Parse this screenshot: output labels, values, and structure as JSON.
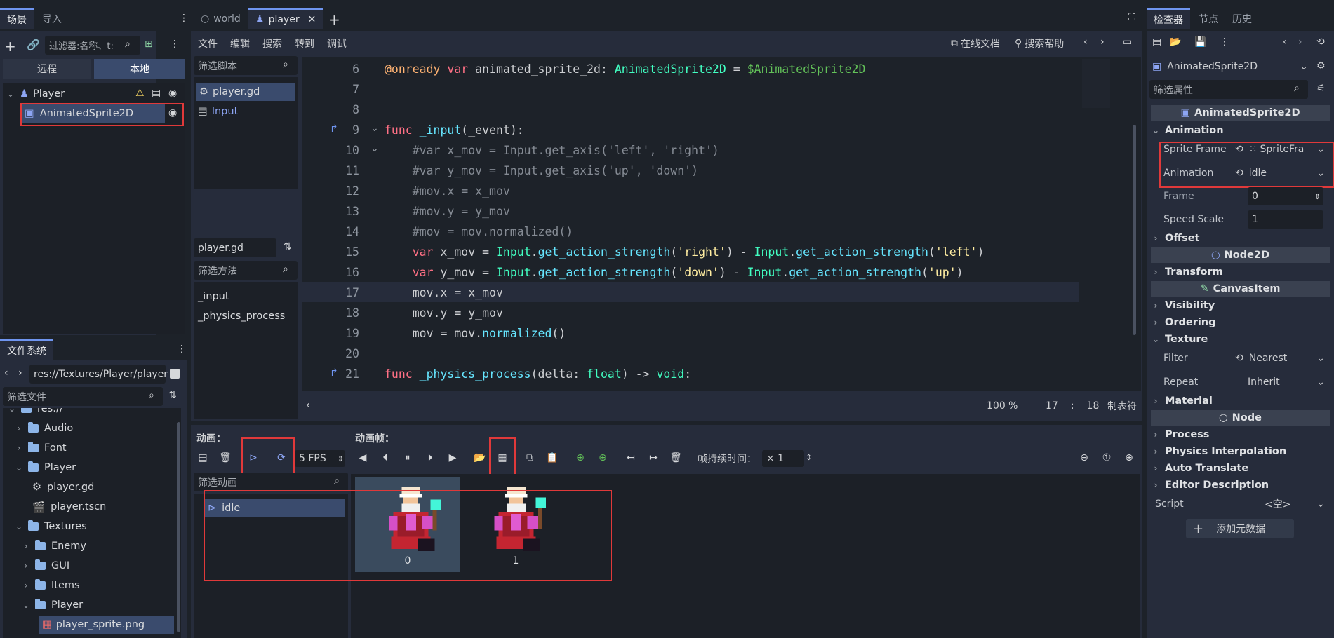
{
  "scene_dock": {
    "tabs": [
      "场景",
      "导入"
    ],
    "filter_placeholder": "过滤器:名称、t:",
    "remote_label": "远程",
    "local_label": "本地",
    "nodes": [
      {
        "name": "Player"
      },
      {
        "name": "AnimatedSprite2D"
      }
    ]
  },
  "filesystem": {
    "tab": "文件系统",
    "path": "res://Textures/Player/player",
    "filter_placeholder": "筛选文件",
    "items": [
      {
        "label": "res://",
        "type": "folder"
      },
      {
        "label": "Audio",
        "type": "folder"
      },
      {
        "label": "Font",
        "type": "folder"
      },
      {
        "label": "Player",
        "type": "folder"
      },
      {
        "label": "player.gd",
        "type": "script"
      },
      {
        "label": "player.tscn",
        "type": "scene"
      },
      {
        "label": "Textures",
        "type": "folder"
      },
      {
        "label": "Enemy",
        "type": "folder"
      },
      {
        "label": "GUI",
        "type": "folder"
      },
      {
        "label": "Items",
        "type": "folder"
      },
      {
        "label": "Player",
        "type": "folder"
      },
      {
        "label": "player_sprite.png",
        "type": "image"
      }
    ]
  },
  "editor": {
    "tabs": [
      "world",
      "player"
    ],
    "menu": [
      "文件",
      "编辑",
      "搜索",
      "转到",
      "调试"
    ],
    "online_docs": "在线文档",
    "search_help": "搜索帮助",
    "filter_scripts": "筛选脚本",
    "scripts": [
      "player.gd",
      "Input"
    ],
    "current_script": "player.gd",
    "filter_methods": "筛选方法",
    "methods": [
      "_input",
      "_physics_process"
    ],
    "zoom": "100 %",
    "line": "17",
    "col": "18",
    "indent": "制表符",
    "code": [
      {
        "n": "6"
      },
      {
        "n": "7"
      },
      {
        "n": "8"
      },
      {
        "n": "9"
      },
      {
        "n": "10"
      },
      {
        "n": "11"
      },
      {
        "n": "12"
      },
      {
        "n": "13"
      },
      {
        "n": "14"
      },
      {
        "n": "15"
      },
      {
        "n": "16"
      },
      {
        "n": "17"
      },
      {
        "n": "18"
      },
      {
        "n": "19"
      },
      {
        "n": "20"
      },
      {
        "n": "21"
      }
    ]
  },
  "sprite_frames": {
    "animations_label": "动画：",
    "frames_label": "动画帧：",
    "fps": "5 FPS",
    "frame_duration_label": "帧持续时间：",
    "frame_duration": "× 1",
    "filter_anim": "筛选动画",
    "animations": [
      "idle"
    ],
    "frames": [
      "0",
      "1"
    ]
  },
  "inspector": {
    "tabs": [
      "检查器",
      "节点",
      "历史"
    ],
    "object": "AnimatedSprite2D",
    "filter_placeholder": "筛选属性",
    "header": "AnimatedSprite2D",
    "animation_section": "Animation",
    "sprite_frames_label": "Sprite Frame",
    "sprite_frames_value": "SpriteFra",
    "animation_label": "Animation",
    "animation_value": "idle",
    "frame_label": "Frame",
    "frame_value": "0",
    "speed_label": "Speed Scale",
    "speed_value": "1",
    "offset": "Offset",
    "node2d": "Node2D",
    "transform": "Transform",
    "canvasitem": "CanvasItem",
    "visibility": "Visibility",
    "ordering": "Ordering",
    "texture": "Texture",
    "filter_label": "Filter",
    "filter_value": "Nearest",
    "repeat_label": "Repeat",
    "repeat_value": "Inherit",
    "material": "Material",
    "node": "Node",
    "process": "Process",
    "physics_interp": "Physics Interpolation",
    "auto_translate": "Auto Translate",
    "editor_desc": "Editor Description",
    "script_label": "Script",
    "script_value": "<空>",
    "add_metadata": "添加元数据"
  }
}
